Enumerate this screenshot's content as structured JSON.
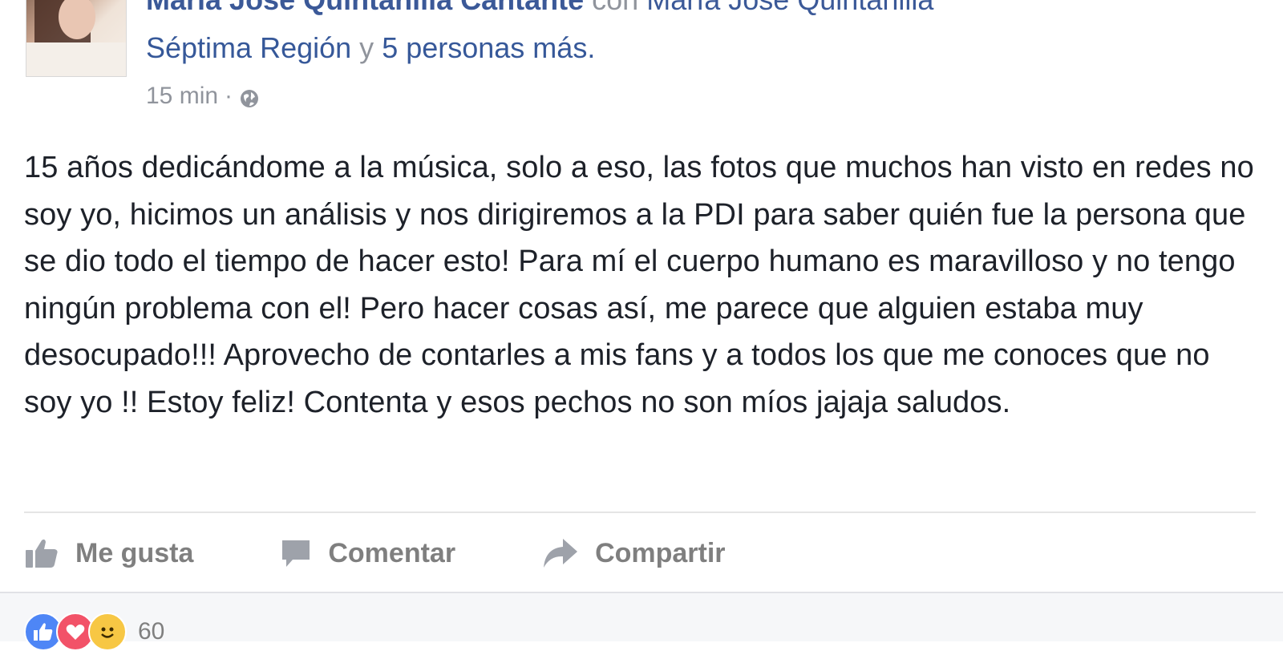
{
  "post": {
    "author": "María José Quintanilla Cantante",
    "with_word": "con",
    "tagged_primary": "María José Quintanilla",
    "tagged_secondary": "Séptima Región",
    "conjunction": "y",
    "others": "5 personas más.",
    "time": "15 min",
    "separator": "·",
    "privacy_icon": "globe-icon",
    "text": "15 años dedicándome a la música, solo a eso, las fotos que muchos han visto en redes no soy yo, hicimos un análisis y nos dirigiremos a la PDI para saber quién fue la persona que se dio todo el tiempo de hacer esto! Para mí el cuerpo humano es maravilloso y no tengo ningún problema con el! Pero hacer cosas así, me parece que alguien estaba muy desocupado!!! Aprovecho de contarles a mis fans y a todos los que me conoces que no soy yo !! Estoy feliz! Contenta y esos pechos no son míos jajaja saludos."
  },
  "actions": {
    "like": {
      "label": "Me gusta",
      "icon": "thumbs-up-icon"
    },
    "comment": {
      "label": "Comentar",
      "icon": "comment-icon"
    },
    "share": {
      "label": "Compartir",
      "icon": "share-icon"
    }
  },
  "reactions": {
    "icons": [
      "like-reaction-icon",
      "love-reaction-icon",
      "wow-reaction-icon"
    ],
    "count": "60"
  },
  "colors": {
    "link": "#365899",
    "meta": "#90949c",
    "text": "#1d2129",
    "action": "#7f7f7f"
  }
}
